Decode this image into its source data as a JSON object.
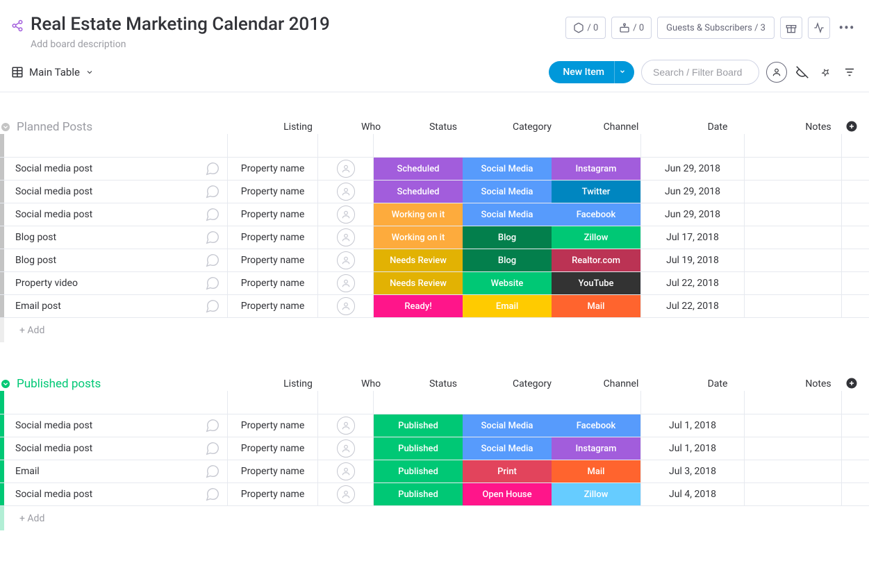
{
  "header": {
    "title": "Real Estate Marketing Calendar 2019",
    "description": "Add board description",
    "zoom_count": "/ 0",
    "robot_count": "/ 0",
    "guests_label": "Guests & Subscribers / 3"
  },
  "toolbar": {
    "view_label": "Main Table",
    "new_item_label": "New Item",
    "search_placeholder": "Search / Filter Board"
  },
  "columns": {
    "listing": "Listing",
    "who": "Who",
    "status": "Status",
    "category": "Category",
    "channel": "Channel",
    "date": "Date",
    "notes": "Notes"
  },
  "add_row_label": "+ Add",
  "groups": [
    {
      "title": "Planned Posts",
      "color": "#c4c4c4",
      "title_color": "#9b9ca3",
      "collapse_color": "#c4c4c4",
      "rows": [
        {
          "name": "Social media post",
          "listing": "Property name",
          "status": {
            "t": "Scheduled",
            "c": "#a25ddc"
          },
          "category": {
            "t": "Social Media",
            "c": "#579bfc"
          },
          "channel": {
            "t": "Instagram",
            "c": "#a25ddc"
          },
          "date": "Jun 29, 2018"
        },
        {
          "name": "Social media post",
          "listing": "Property name",
          "status": {
            "t": "Scheduled",
            "c": "#a25ddc"
          },
          "category": {
            "t": "Social Media",
            "c": "#579bfc"
          },
          "channel": {
            "t": "Twitter",
            "c": "#0086c0"
          },
          "date": "Jun 29, 2018"
        },
        {
          "name": "Social media post",
          "listing": "Property name",
          "status": {
            "t": "Working on it",
            "c": "#fdab3d"
          },
          "category": {
            "t": "Social Media",
            "c": "#579bfc"
          },
          "channel": {
            "t": "Facebook",
            "c": "#579bfc"
          },
          "date": "Jun 29, 2018"
        },
        {
          "name": "Blog post",
          "listing": "Property name",
          "status": {
            "t": "Working on it",
            "c": "#fdab3d"
          },
          "category": {
            "t": "Blog",
            "c": "#037f4c"
          },
          "channel": {
            "t": "Zillow",
            "c": "#00c875"
          },
          "date": "Jul 17, 2018"
        },
        {
          "name": "Blog post",
          "listing": "Property name",
          "status": {
            "t": "Needs Review",
            "c": "#e2b203"
          },
          "category": {
            "t": "Blog",
            "c": "#037f4c"
          },
          "channel": {
            "t": "Realtor.com",
            "c": "#bb3354"
          },
          "date": "Jul 19, 2018"
        },
        {
          "name": "Property video",
          "listing": "Property name",
          "status": {
            "t": "Needs Review",
            "c": "#e2b203"
          },
          "category": {
            "t": "Website",
            "c": "#00c875"
          },
          "channel": {
            "t": "YouTube",
            "c": "#333333"
          },
          "date": "Jul 22, 2018"
        },
        {
          "name": "Email post",
          "listing": "Property name",
          "status": {
            "t": "Ready!",
            "c": "#ff158a"
          },
          "category": {
            "t": "Email",
            "c": "#ffcb00"
          },
          "channel": {
            "t": "Mail",
            "c": "#ff642e"
          },
          "date": "Jul 22, 2018"
        }
      ]
    },
    {
      "title": "Published posts",
      "color": "#00c875",
      "title_color": "#00c875",
      "collapse_color": "#00c875",
      "rows": [
        {
          "name": "Social media post",
          "listing": "Property name",
          "status": {
            "t": "Published",
            "c": "#00c875"
          },
          "category": {
            "t": "Social Media",
            "c": "#579bfc"
          },
          "channel": {
            "t": "Facebook",
            "c": "#579bfc"
          },
          "date": "Jul 1, 2018"
        },
        {
          "name": "Social media post",
          "listing": "Property name",
          "status": {
            "t": "Published",
            "c": "#00c875"
          },
          "category": {
            "t": "Social Media",
            "c": "#579bfc"
          },
          "channel": {
            "t": "Instagram",
            "c": "#a25ddc"
          },
          "date": "Jul 1, 2018"
        },
        {
          "name": "Email",
          "listing": "Property name",
          "status": {
            "t": "Published",
            "c": "#00c875"
          },
          "category": {
            "t": "Print",
            "c": "#e2445c"
          },
          "channel": {
            "t": "Mail",
            "c": "#ff642e"
          },
          "date": "Jul 3, 2018"
        },
        {
          "name": "Social media post",
          "listing": "Property name",
          "status": {
            "t": "Published",
            "c": "#00c875"
          },
          "category": {
            "t": "Open House",
            "c": "#ff158a"
          },
          "channel": {
            "t": "Zillow",
            "c": "#66ccff"
          },
          "date": "Jul 4, 2018"
        }
      ]
    }
  ]
}
